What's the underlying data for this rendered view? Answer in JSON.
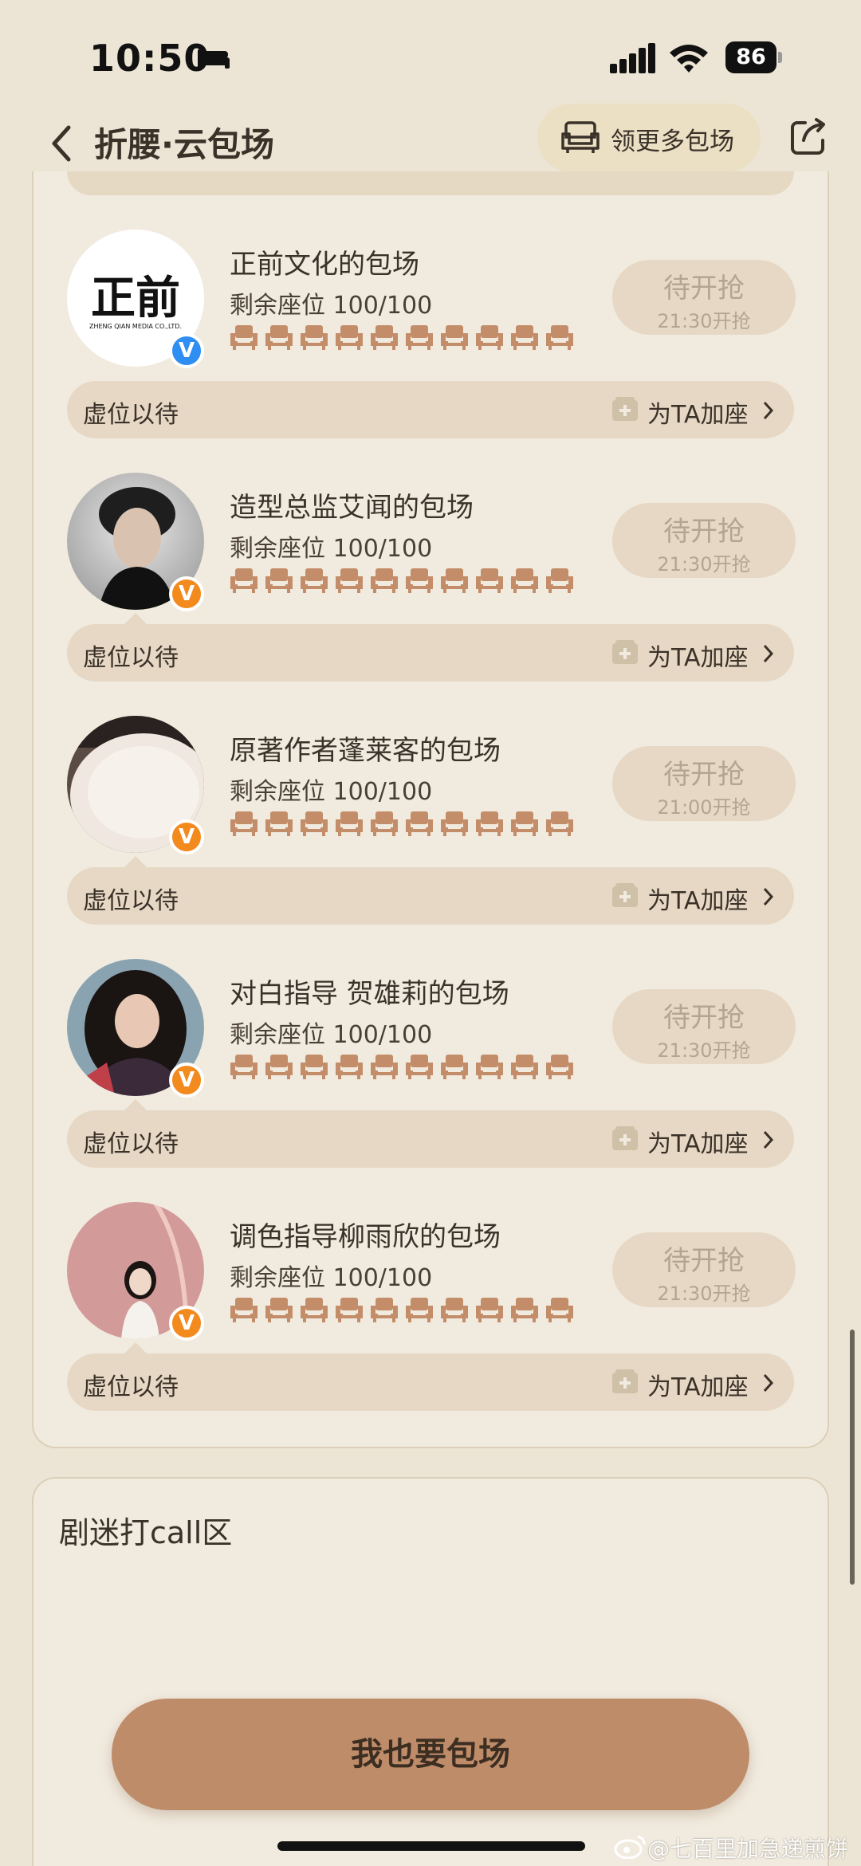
{
  "status_bar": {
    "time": "10:50",
    "battery": "86"
  },
  "nav": {
    "title": "折腰·云包场",
    "more_label": "领更多包场"
  },
  "cards": [
    {
      "title": "正前文化的包场",
      "seats": "剩余座位 100/100",
      "btn_main": "待开抢",
      "btn_time": "21:30开抢",
      "wait": "虚位以待",
      "add": "为TA加座",
      "badge": "V",
      "badge_color": "#2e8ef2",
      "logo_text": "正前",
      "logo_sub": "ZHENG QIAN MEDIA CO.,LTD."
    },
    {
      "title": "造型总监艾闻的包场",
      "seats": "剩余座位 100/100",
      "btn_main": "待开抢",
      "btn_time": "21:30开抢",
      "wait": "虚位以待",
      "add": "为TA加座",
      "badge": "V",
      "badge_color": "#f28a1e"
    },
    {
      "title": "原著作者蓬莱客的包场",
      "seats": "剩余座位 100/100",
      "btn_main": "待开抢",
      "btn_time": "21:00开抢",
      "wait": "虚位以待",
      "add": "为TA加座",
      "badge": "V",
      "badge_color": "#f28a1e"
    },
    {
      "title": "对白指导 贺雄莉的包场",
      "seats": "剩余座位 100/100",
      "btn_main": "待开抢",
      "btn_time": "21:30开抢",
      "wait": "虚位以待",
      "add": "为TA加座",
      "badge": "V",
      "badge_color": "#f28a1e"
    },
    {
      "title": "调色指导柳雨欣的包场",
      "seats": "剩余座位 100/100",
      "btn_main": "待开抢",
      "btn_time": "21:30开抢",
      "wait": "虚位以待",
      "add": "为TA加座",
      "badge": "V",
      "badge_color": "#f28a1e"
    }
  ],
  "fans": {
    "title": "剧迷打call区"
  },
  "cta": {
    "label": "我也要包场"
  },
  "watermark": "@七百里加急递煎饼",
  "colors": {
    "seat": "#c48d6a",
    "accent": "#bf8c6a",
    "bg": "#ece5d5"
  }
}
